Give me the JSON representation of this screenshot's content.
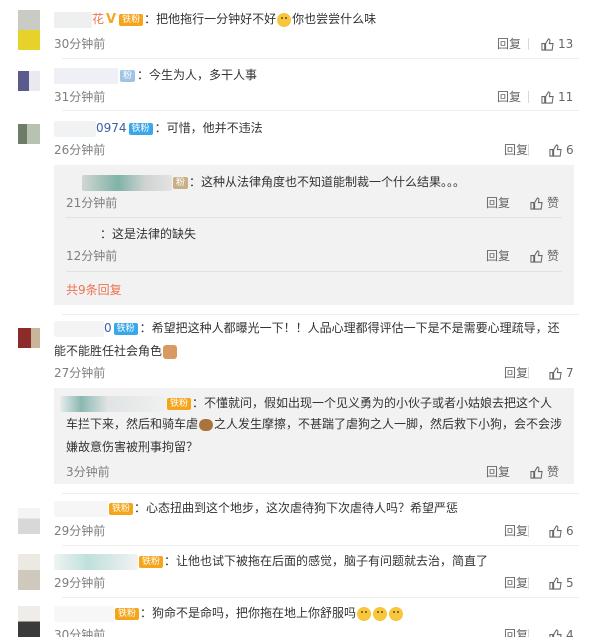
{
  "common": {
    "reply_label": "回复",
    "like_label": "赞"
  },
  "comments": [
    {
      "name": "花",
      "text": "把他拖行一分钟好不好",
      "text2": "你也尝尝什么味",
      "time": "30分钟前",
      "likes": "13"
    },
    {
      "name": "",
      "text": "今生为人，多干人事",
      "time": "31分钟前",
      "likes": "11"
    },
    {
      "name": "0974",
      "badge": "铁粉",
      "text": "可惜，他并不违法",
      "time": "26分钟前",
      "likes": "6"
    },
    {
      "name": "0",
      "badge": "铁粉",
      "text": "希望把这种人都曝光一下！！人品心理都得评估一下是不是需要心理疏导，还",
      "text2": "能不能胜任社会角色",
      "time": "27分钟前",
      "likes": "7"
    },
    {
      "name": "",
      "badge": "铁粉",
      "text": "心态扭曲到这个地步，这次虐待狗下次虐待人吗？希望严惩",
      "time": "29分钟前",
      "likes": "6"
    },
    {
      "name": "",
      "badge": "铁粉",
      "text": "让他也试下被拖在后面的感觉，脑子有问题就去治，简直了",
      "time": "29分钟前",
      "likes": "5"
    },
    {
      "name": "",
      "badge": "铁粉",
      "text": "狗命不是命吗，把你拖在地上你舒服吗",
      "time": "30分钟前",
      "likes": "4"
    }
  ],
  "replies_block_1": {
    "items": [
      {
        "text": "这种从法律角度也不知道能制裁一个什么结果。。。",
        "time": "21分钟前"
      },
      {
        "text": "这是法律的缺失",
        "time": "12分钟前"
      }
    ],
    "more_label": "共9条回复"
  },
  "replies_block_2": {
    "items": [
      {
        "badge": "铁粉",
        "text": "不懂就问，假如出现一个见义勇为的小伙子或者小姑娘去把这个人",
        "text2": "车拦下来，然后和骑车虐",
        "text3": "之人发生摩擦，不甚踹了虐狗之人一脚，然后救下小狗，会不会涉",
        "text4": "嫌故意伤害被刑事拘留？",
        "time": "3分钟前"
      }
    ]
  },
  "colors": {
    "badge": "#3ba7e8",
    "gold_badge": "#f4a51c",
    "link": "#eb7350",
    "time": "#7e7e7e"
  }
}
